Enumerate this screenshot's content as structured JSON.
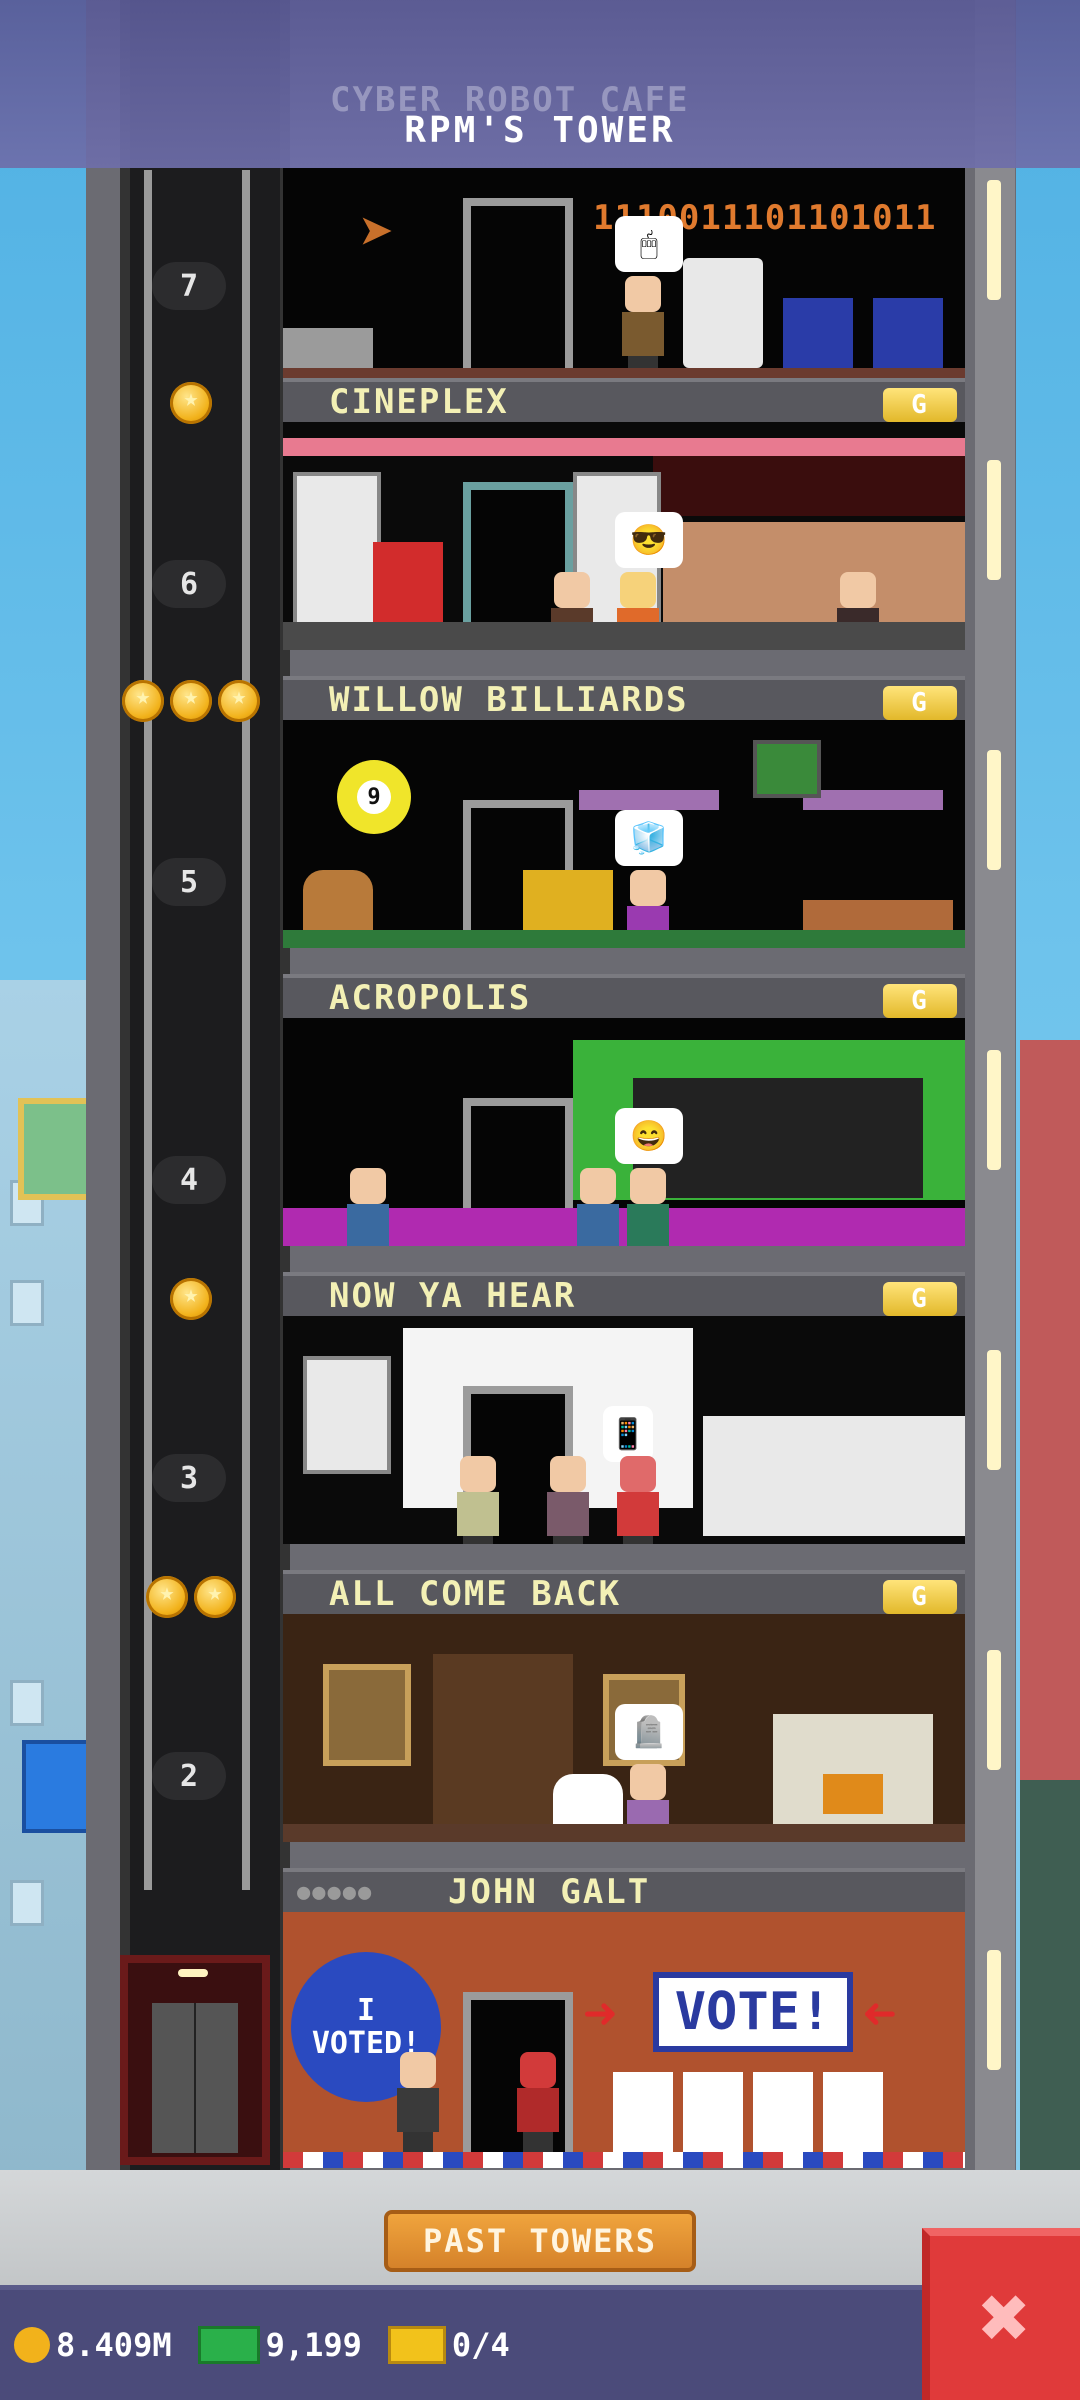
{
  "header": {
    "tower_name": "RPM'S TOWER",
    "top_floor_label": "CYBER ROBOT CAFE"
  },
  "floors": [
    {
      "number": "7",
      "label": "CINEPLEX",
      "badge": "G",
      "coins": 1,
      "binary_text": "1110011101101011",
      "bubble": "🖱"
    },
    {
      "number": "6",
      "label": "WILLOW BILLIARDS",
      "badge": "G",
      "coins": 3,
      "bubble": "😎"
    },
    {
      "number": "5",
      "label": "ACROPOLIS",
      "badge": "G",
      "coins": 0,
      "bubble": "🧊",
      "ball_number": "9"
    },
    {
      "number": "4",
      "label": "NOW YA HEAR",
      "badge": "G",
      "coins": 1,
      "bubble": "😄"
    },
    {
      "number": "3",
      "label": "ALL COME BACK",
      "badge": "G",
      "coins": 2,
      "bubble": "🎵"
    },
    {
      "number": "2",
      "label": "JOHN GALT",
      "badge": "",
      "coins": 0,
      "bubble": "🪦"
    }
  ],
  "lobby": {
    "vote_sign": "VOTE!",
    "voted_badge_line1": "I",
    "voted_badge_line2": "VOTED!"
  },
  "buttons": {
    "past_towers": "PAST TOWERS",
    "close": "✖"
  },
  "stats": {
    "coins": "8.409M",
    "bux": "9,199",
    "tickets": "0/4"
  },
  "colors": {
    "label_text": "#f3f0b5",
    "badge_gold": "#e2b82a",
    "close_red": "#e03a3a",
    "past_btn_orange": "#e0922f"
  }
}
